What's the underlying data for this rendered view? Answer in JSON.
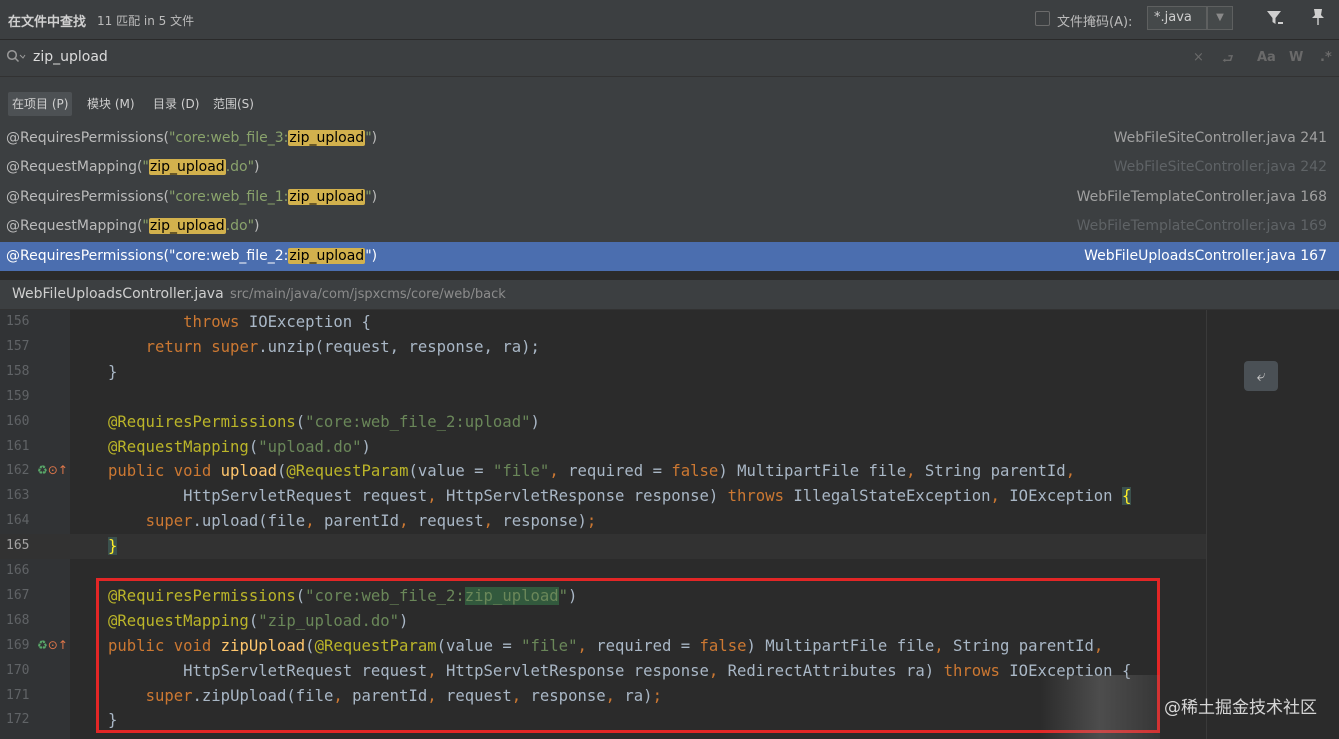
{
  "header": {
    "title": "在文件中查找",
    "match_count": "11 匹配 in 5 文件",
    "file_mask_label": "文件掩码(A):",
    "file_mask_value": "*.java",
    "dropdown_glyph": "▼",
    "filter_glyph": "▼̲",
    "pin_glyph": "📌"
  },
  "search": {
    "icon_glyph": "⌕",
    "query": "zip_upload",
    "tools": {
      "clear": "×",
      "wrap": "⮐",
      "match_case": "Aa",
      "words": "W",
      "regex": ".*"
    }
  },
  "scope_tabs": [
    {
      "label": "在项目 (P)",
      "active": true
    },
    {
      "label": "模块 (M)",
      "active": false
    },
    {
      "label": "目录 (D)",
      "active": false
    },
    {
      "label": "范围(S)",
      "active": false
    }
  ],
  "results": [
    {
      "pre": "@RequiresPermissions(",
      "str_pre": "\"core:web_file_3:",
      "match": "zip_upload",
      "str_post": "\"",
      "post": ")",
      "file": "WebFileSiteController.java 241",
      "dim": false,
      "selected": false
    },
    {
      "pre": "@RequestMapping(",
      "str_pre": "\"",
      "match": "zip_upload",
      "str_post": ".do\"",
      "post": ")",
      "file": "WebFileSiteController.java 242",
      "dim": true,
      "selected": false
    },
    {
      "pre": "@RequiresPermissions(",
      "str_pre": "\"core:web_file_1:",
      "match": "zip_upload",
      "str_post": "\"",
      "post": ")",
      "file": "WebFileTemplateController.java 168",
      "dim": false,
      "selected": false
    },
    {
      "pre": "@RequestMapping(",
      "str_pre": "\"",
      "match": "zip_upload",
      "str_post": ".do\"",
      "post": ")",
      "file": "WebFileTemplateController.java 169",
      "dim": true,
      "selected": false
    },
    {
      "pre": "@RequiresPermissions(",
      "str_pre": "\"core:web_file_2:",
      "match": "zip_upload",
      "str_post": "\"",
      "post": ")",
      "file": "WebFileUploadsController.java 167",
      "dim": false,
      "selected": true
    }
  ],
  "preview": {
    "file_name": "WebFileUploadsController.java",
    "file_path": "src/main/java/com/jspxcms/core/web/back",
    "softwrap_glyph": "⤶",
    "current_line": "165",
    "lines": [
      {
        "n": "156",
        "segs": [
          [
            "",
            "        "
          ],
          [
            "kw",
            "throws "
          ],
          [
            "",
            "IOException {"
          ]
        ]
      },
      {
        "n": "157",
        "segs": [
          [
            "",
            "    "
          ],
          [
            "kw",
            "return super"
          ],
          [
            "",
            ".unzip(request, response, ra);"
          ]
        ]
      },
      {
        "n": "158",
        "segs": [
          [
            "",
            "}"
          ]
        ]
      },
      {
        "n": "159",
        "segs": []
      },
      {
        "n": "160",
        "segs": [
          [
            "an",
            "@RequiresPermissions"
          ],
          [
            "",
            "("
          ],
          [
            "st",
            "\"core:web_file_2:upload\""
          ],
          [
            "",
            ")"
          ]
        ]
      },
      {
        "n": "161",
        "segs": [
          [
            "an",
            "@RequestMapping"
          ],
          [
            "",
            "("
          ],
          [
            "st",
            "\"upload.do\""
          ],
          [
            "",
            ")"
          ]
        ]
      },
      {
        "n": "162",
        "icons": true,
        "segs": [
          [
            "kw",
            "public void "
          ],
          [
            "mh",
            "upload"
          ],
          [
            "",
            "("
          ],
          [
            "an",
            "@RequestParam"
          ],
          [
            "",
            "(value = "
          ],
          [
            "st",
            "\"file\""
          ],
          [
            "kw",
            ", "
          ],
          [
            "",
            "required = "
          ],
          [
            "kw",
            "false"
          ],
          [
            "",
            ") MultipartFile file"
          ],
          [
            "kw",
            ", "
          ],
          [
            "",
            "String parentId"
          ],
          [
            "kw",
            ","
          ]
        ]
      },
      {
        "n": "163",
        "segs": [
          [
            "",
            "        HttpServletRequest request"
          ],
          [
            "kw",
            ", "
          ],
          [
            "",
            "HttpServletResponse response) "
          ],
          [
            "kw",
            "throws "
          ],
          [
            "",
            "IllegalStateException"
          ],
          [
            "kw",
            ", "
          ],
          [
            "",
            "IOException "
          ],
          [
            "br",
            "{"
          ]
        ]
      },
      {
        "n": "164",
        "segs": [
          [
            "",
            "    "
          ],
          [
            "kw",
            "super"
          ],
          [
            "",
            ".upload(file"
          ],
          [
            "kw",
            ", "
          ],
          [
            "",
            "parentId"
          ],
          [
            "kw",
            ", "
          ],
          [
            "",
            "request"
          ],
          [
            "kw",
            ", "
          ],
          [
            "",
            "response)"
          ],
          [
            "kw",
            ";"
          ]
        ]
      },
      {
        "n": "165",
        "segs": [
          [
            "br",
            "}"
          ]
        ]
      },
      {
        "n": "166",
        "segs": []
      },
      {
        "n": "167",
        "segs": [
          [
            "an",
            "@RequiresPermissions"
          ],
          [
            "",
            "("
          ],
          [
            "st",
            "\"core:web_file_2:"
          ],
          [
            "st mt",
            "zip_upload"
          ],
          [
            "st",
            "\""
          ],
          [
            "",
            ")"
          ]
        ]
      },
      {
        "n": "168",
        "segs": [
          [
            "an",
            "@RequestMapping"
          ],
          [
            "",
            "("
          ],
          [
            "st",
            "\"zip_upload.do\""
          ],
          [
            "",
            ")"
          ]
        ]
      },
      {
        "n": "169",
        "icons": true,
        "segs": [
          [
            "kw",
            "public void "
          ],
          [
            "mh",
            "zipUpload"
          ],
          [
            "",
            "("
          ],
          [
            "an",
            "@RequestParam"
          ],
          [
            "",
            "(value = "
          ],
          [
            "st",
            "\"file\""
          ],
          [
            "kw",
            ", "
          ],
          [
            "",
            "required = "
          ],
          [
            "kw",
            "false"
          ],
          [
            "",
            ") MultipartFile file"
          ],
          [
            "kw",
            ", "
          ],
          [
            "",
            "String parentId"
          ],
          [
            "kw",
            ","
          ]
        ]
      },
      {
        "n": "170",
        "segs": [
          [
            "",
            "        HttpServletRequest request"
          ],
          [
            "kw",
            ", "
          ],
          [
            "",
            "HttpServletResponse response"
          ],
          [
            "kw",
            ", "
          ],
          [
            "",
            "RedirectAttributes ra) "
          ],
          [
            "kw",
            "throws "
          ],
          [
            "",
            "IOException {"
          ]
        ]
      },
      {
        "n": "171",
        "segs": [
          [
            "",
            "    "
          ],
          [
            "kw",
            "super"
          ],
          [
            "",
            ".zipUpload(file"
          ],
          [
            "kw",
            ", "
          ],
          [
            "",
            "parentId"
          ],
          [
            "kw",
            ", "
          ],
          [
            "",
            "request"
          ],
          [
            "kw",
            ", "
          ],
          [
            "",
            "response"
          ],
          [
            "kw",
            ", "
          ],
          [
            "",
            "ra)"
          ],
          [
            "kw",
            ";"
          ]
        ]
      },
      {
        "n": "172",
        "segs": [
          [
            "",
            "}"
          ]
        ]
      }
    ]
  },
  "gutter_icons": {
    "run": "♻",
    "override": "⊙↑"
  },
  "watermark": "@稀土掘金技术社区",
  "colors": {
    "keyword": "#cc7832",
    "annotation": "#bbb529",
    "string": "#6a8759",
    "method": "#ffc66d",
    "selection": "#4b6eaf",
    "match_highlight": "#d2b14d",
    "red_box": "#e32626"
  }
}
